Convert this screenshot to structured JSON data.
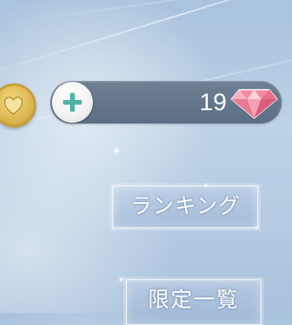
{
  "currency": {
    "coin_icon": "heart-coin-icon",
    "plus_icon": "plus-icon",
    "gem_count": "19",
    "gem_icon": "pink-diamond-icon"
  },
  "menu": {
    "ranking_label": "ランキング",
    "limited_label": "限定一覧"
  },
  "colors": {
    "background": "#b8cee4",
    "currency_bar": "#64768c",
    "plus_accent": "#4fb3a6",
    "coin_gold": "#d9b24a",
    "gem_pink": "#f08aa0",
    "button_border": "#ffffff"
  }
}
